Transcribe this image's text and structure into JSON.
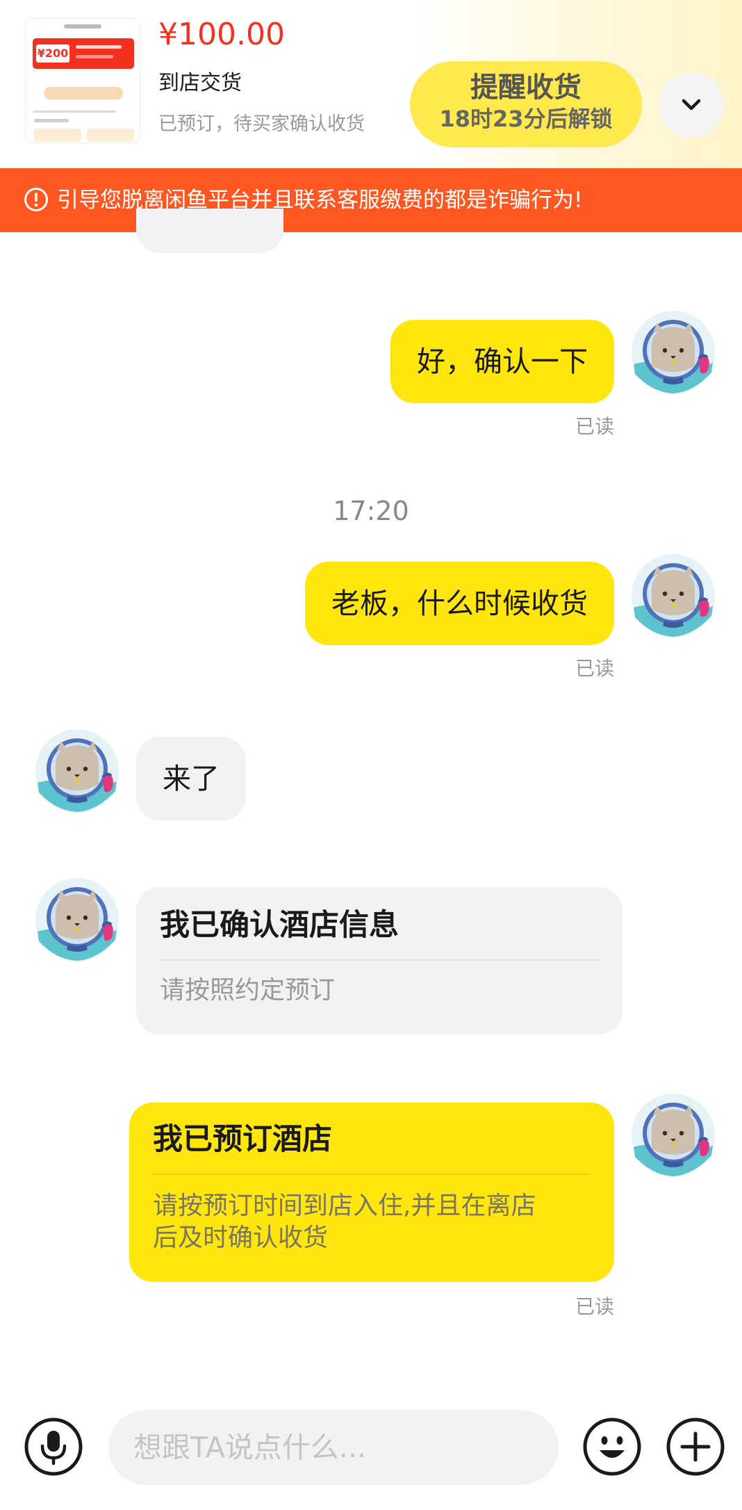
{
  "order": {
    "price": "¥100.00",
    "delivery": "到店交货",
    "status": "已预订，待买家确认收货",
    "thumbnail_coupon": "¥200",
    "remind_button": {
      "title": "提醒收货",
      "subtitle": "18时23分后解锁"
    },
    "expand_icon": "chevron-down-icon"
  },
  "warning": {
    "icon": "warning-circle-icon",
    "text": "引导您脱离闲鱼平台并且联系客服缴费的都是诈骗行为!"
  },
  "messages": {
    "m1": {
      "text": "好，确认一下",
      "status": "已读"
    },
    "time1": "17:20",
    "m2": {
      "text": "老板，什么时候收货",
      "status": "已读"
    },
    "m3": {
      "text": "来了"
    },
    "card_in": {
      "title": "我已确认酒店信息",
      "body": "请按照约定预订"
    },
    "card_out": {
      "title": "我已预订酒店",
      "body_line1": "请按预订时间到店入住,并且在离店",
      "body_line2": "后及时确认收货",
      "status": "已读"
    }
  },
  "input_bar": {
    "placeholder": "想跟TA说点什么...",
    "icons": [
      "microphone-icon",
      "emoji-icon",
      "plus-icon"
    ]
  },
  "colors": {
    "accent_yellow": "#ffe60f",
    "price_red": "#f2311f",
    "warning_orange": "#ff5722",
    "incoming_bubble": "#f2f2f4"
  }
}
